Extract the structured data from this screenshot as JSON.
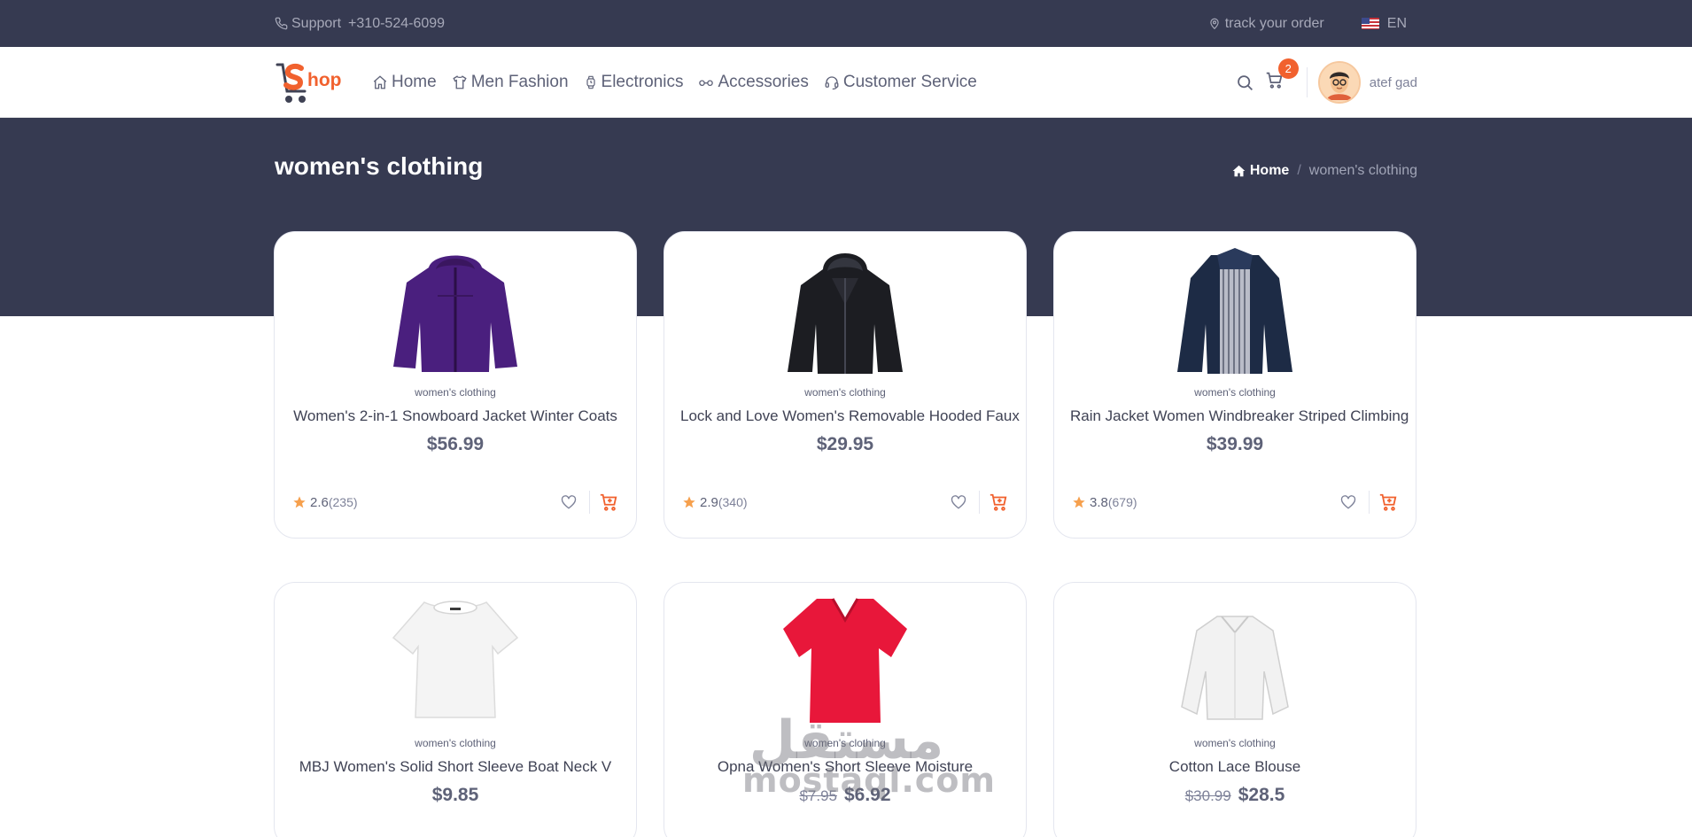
{
  "topbar": {
    "support_label": "Support",
    "phone": "+310-524-6099",
    "track_label": "track your order",
    "language": "EN"
  },
  "header": {
    "logo_text": "hop",
    "nav": [
      {
        "label": "Home",
        "icon": "home-icon"
      },
      {
        "label": "Men Fashion",
        "icon": "shirt-icon"
      },
      {
        "label": "Electronics",
        "icon": "watch-icon"
      },
      {
        "label": "Accessories",
        "icon": "glasses-icon"
      },
      {
        "label": "Customer Service",
        "icon": "headset-icon"
      }
    ],
    "cart_count": "2",
    "username": "atef gad"
  },
  "page": {
    "title": "women's clothing",
    "breadcrumb_home": "Home",
    "breadcrumb_current": "women's clothing"
  },
  "products": [
    {
      "category": "women's clothing",
      "title": "Women's 2-in-1 Snowboard Jacket Winter Coats",
      "price": "$56.99",
      "old_price": "",
      "rating": "2.6",
      "count": "(235)",
      "color": "#4a1f7e"
    },
    {
      "category": "women's clothing",
      "title": "Lock and Love Women's Removable Hooded Faux",
      "price": "$29.95",
      "old_price": "",
      "rating": "2.9",
      "count": "(340)",
      "color": "#1c1d22"
    },
    {
      "category": "women's clothing",
      "title": "Rain Jacket Women Windbreaker Striped Climbing",
      "price": "$39.99",
      "old_price": "",
      "rating": "3.8",
      "count": "(679)",
      "color": "#1d2b45"
    },
    {
      "category": "women's clothing",
      "title": "MBJ Women's Solid Short Sleeve Boat Neck V",
      "price": "$9.85",
      "old_price": "",
      "rating": "",
      "count": "",
      "color": "#f3f3f3"
    },
    {
      "category": "women's clothing",
      "title": "Opna Women's Short Sleeve Moisture",
      "price": "$6.92",
      "old_price": "$7.95",
      "rating": "",
      "count": "",
      "color": "#e8173a"
    },
    {
      "category": "women's clothing",
      "title": "Cotton Lace Blouse",
      "price": "$28.5",
      "old_price": "$30.99",
      "rating": "",
      "count": "",
      "color": "#f1f1f1"
    }
  ],
  "watermark": {
    "arabic": "مستقل",
    "latin": "mostaql.com"
  },
  "colors": {
    "dark": "#363a51",
    "accent": "#f1612e",
    "star": "#f6a04d"
  }
}
